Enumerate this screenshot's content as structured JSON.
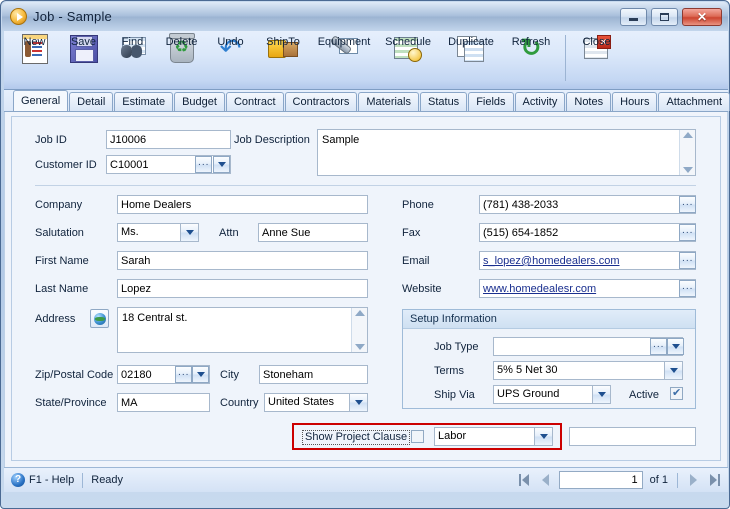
{
  "window": {
    "title": "Job - Sample",
    "icon": "play-circle-icon",
    "controls": {
      "minimize": "minimize-icon",
      "maximize": "maximize-icon",
      "close": "✕"
    }
  },
  "toolbar": {
    "buttons": [
      {
        "label": "New",
        "icon": "new-document-icon"
      },
      {
        "label": "Save",
        "icon": "floppy-disk-icon"
      },
      {
        "label": "Find",
        "icon": "binoculars-icon"
      },
      {
        "label": "Delete",
        "icon": "recycle-bin-icon"
      },
      {
        "label": "Undo",
        "icon": "undo-arrow-icon"
      },
      {
        "label": "ShipTo",
        "icon": "forklift-icon"
      },
      {
        "label": "Equipment",
        "icon": "wrench-icon"
      },
      {
        "label": "Schedule",
        "icon": "schedule-clock-icon"
      },
      {
        "label": "Duplicate",
        "icon": "duplicate-pages-icon"
      },
      {
        "label": "Refresh",
        "icon": "refresh-arrows-icon"
      },
      {
        "label": "Close",
        "icon": "close-window-icon"
      }
    ]
  },
  "tabs": [
    {
      "label": "General",
      "active": true
    },
    {
      "label": "Detail",
      "active": false
    },
    {
      "label": "Estimate",
      "active": false
    },
    {
      "label": "Budget",
      "active": false
    },
    {
      "label": "Contract",
      "active": false
    },
    {
      "label": "Contractors",
      "active": false
    },
    {
      "label": "Materials",
      "active": false
    },
    {
      "label": "Status",
      "active": false
    },
    {
      "label": "Fields",
      "active": false
    },
    {
      "label": "Activity",
      "active": false
    },
    {
      "label": "Notes",
      "active": false
    },
    {
      "label": "Hours",
      "active": false
    },
    {
      "label": "Attachment",
      "active": false
    }
  ],
  "form": {
    "job_id": {
      "label": "Job ID",
      "value": "J10006"
    },
    "customer_id": {
      "label": "Customer ID",
      "value": "C10001"
    },
    "job_description": {
      "label": "Job Description",
      "value": "Sample"
    },
    "company": {
      "label": "Company",
      "value": "Home Dealers"
    },
    "salutation": {
      "label": "Salutation",
      "value": "Ms."
    },
    "attn": {
      "label": "Attn",
      "value": "Anne Sue"
    },
    "first_name": {
      "label": "First Name",
      "value": "Sarah"
    },
    "last_name": {
      "label": "Last Name",
      "value": "Lopez"
    },
    "address": {
      "label": "Address",
      "value": "18 Central st.",
      "icon": "globe-icon"
    },
    "zip": {
      "label": "Zip/Postal Code",
      "value": "02180"
    },
    "city": {
      "label": "City",
      "value": "Stoneham"
    },
    "state": {
      "label": "State/Province",
      "value": "MA"
    },
    "country": {
      "label": "Country",
      "value": "United States"
    },
    "phone": {
      "label": "Phone",
      "value": "(781) 438-2033"
    },
    "fax": {
      "label": "Fax",
      "value": "(515) 654-1852"
    },
    "email": {
      "label": "Email",
      "value": "s_lopez@homedealers.com"
    },
    "website": {
      "label": "Website",
      "value": "www.homedealesr.com"
    }
  },
  "setup_information": {
    "title": "Setup Information",
    "job_type": {
      "label": "Job Type",
      "value": ""
    },
    "terms": {
      "label": "Terms",
      "value": "5% 5 Net 30"
    },
    "ship_via": {
      "label": "Ship Via",
      "value": "UPS Ground"
    },
    "active": {
      "label": "Active",
      "checked": true
    }
  },
  "project_clause": {
    "label": "Show Project Clause",
    "checked": false,
    "dropdown_value": "Labor",
    "text_value": "",
    "highlight_color": "#cc0000"
  },
  "statusbar": {
    "help": "F1 - Help",
    "status": "Ready",
    "page_value": "1",
    "of_text": "of 1",
    "nav": {
      "first": "first-page-icon",
      "prev": "previous-page-icon",
      "next": "next-page-icon",
      "last": "last-page-icon"
    }
  }
}
